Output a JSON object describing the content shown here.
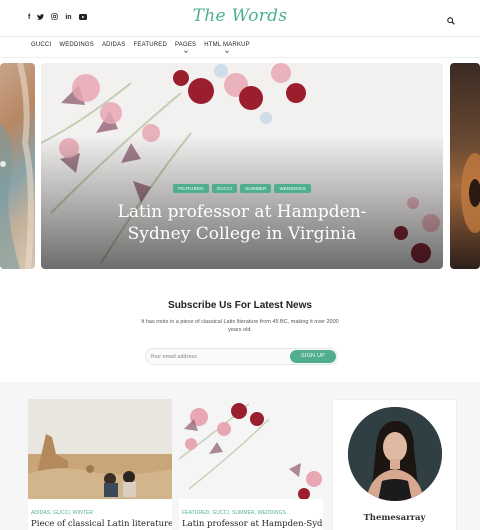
{
  "header": {
    "social_icons": [
      "facebook-icon",
      "twitter-icon",
      "instagram-icon",
      "linkedin-icon",
      "youtube-icon"
    ],
    "social_glyphs": [
      "f",
      "🐦",
      "◎",
      "in",
      "▶"
    ],
    "logo": "The Words",
    "search_icon": "search-icon"
  },
  "nav": {
    "items": [
      "GUCCI",
      "WEDDINGS",
      "ADIDAS",
      "FEATURED",
      "PAGES",
      "HTML MARKUP"
    ]
  },
  "hero": {
    "tags": [
      "FEATURED",
      "GUCCI",
      "SUMMER",
      "WEDDINGS"
    ],
    "title": "Latin professor at Hampden-Sydney College in Virginia"
  },
  "subscribe": {
    "title": "Subscribe Us For Latest News",
    "description": "It has roots in a piece of classical Latin literature from 45 BC, making it over 2000 years old.",
    "email_placeholder": "Your email address",
    "button_label": "SIGN UP"
  },
  "posts": [
    {
      "categories": "ADIDAS, GUCCI, WINTER",
      "title": "Piece of classical Latin literature"
    },
    {
      "categories": "FEATURED, GUCCI, SUMMER, WEDDINGS",
      "title": "Latin professor at Hampden-Sydney"
    }
  ],
  "author": {
    "name": "Themesarray"
  },
  "colors": {
    "accent": "#4fae90",
    "logo": "#4caf91"
  }
}
